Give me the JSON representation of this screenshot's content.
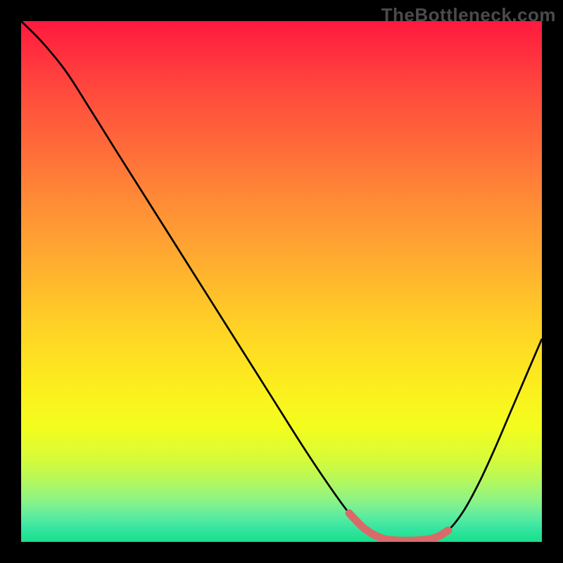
{
  "watermark": "TheBottleneck.com",
  "chart_data": {
    "type": "line",
    "title": "",
    "xlabel": "",
    "ylabel": "",
    "xlim": [
      0,
      1
    ],
    "ylim": [
      0,
      1
    ],
    "grid": false,
    "series": [
      {
        "name": "bottleneck-curve",
        "color": "#000000",
        "points": [
          {
            "x": 0.0,
            "y": 1.0
          },
          {
            "x": 0.04,
            "y": 0.96
          },
          {
            "x": 0.085,
            "y": 0.905
          },
          {
            "x": 0.13,
            "y": 0.835
          },
          {
            "x": 0.18,
            "y": 0.755
          },
          {
            "x": 0.24,
            "y": 0.66
          },
          {
            "x": 0.3,
            "y": 0.565
          },
          {
            "x": 0.36,
            "y": 0.47
          },
          {
            "x": 0.42,
            "y": 0.375
          },
          {
            "x": 0.48,
            "y": 0.28
          },
          {
            "x": 0.54,
            "y": 0.185
          },
          {
            "x": 0.59,
            "y": 0.11
          },
          {
            "x": 0.63,
            "y": 0.055
          },
          {
            "x": 0.66,
            "y": 0.025
          },
          {
            "x": 0.69,
            "y": 0.008
          },
          {
            "x": 0.72,
            "y": 0.003
          },
          {
            "x": 0.76,
            "y": 0.003
          },
          {
            "x": 0.795,
            "y": 0.008
          },
          {
            "x": 0.82,
            "y": 0.022
          },
          {
            "x": 0.85,
            "y": 0.06
          },
          {
            "x": 0.88,
            "y": 0.115
          },
          {
            "x": 0.91,
            "y": 0.18
          },
          {
            "x": 0.94,
            "y": 0.25
          },
          {
            "x": 0.97,
            "y": 0.32
          },
          {
            "x": 1.0,
            "y": 0.39
          }
        ]
      }
    ],
    "highlight_segment": {
      "color": "#d96a6a",
      "points": [
        {
          "x": 0.63,
          "y": 0.055
        },
        {
          "x": 0.66,
          "y": 0.025
        },
        {
          "x": 0.69,
          "y": 0.008
        },
        {
          "x": 0.72,
          "y": 0.003
        },
        {
          "x": 0.76,
          "y": 0.003
        },
        {
          "x": 0.795,
          "y": 0.008
        },
        {
          "x": 0.82,
          "y": 0.022
        }
      ]
    },
    "gradient_stops": [
      {
        "pos": 0.0,
        "color": "#ff193e"
      },
      {
        "pos": 0.5,
        "color": "#ffb82c"
      },
      {
        "pos": 0.78,
        "color": "#f3fd1e"
      },
      {
        "pos": 1.0,
        "color": "#18df89"
      }
    ]
  }
}
